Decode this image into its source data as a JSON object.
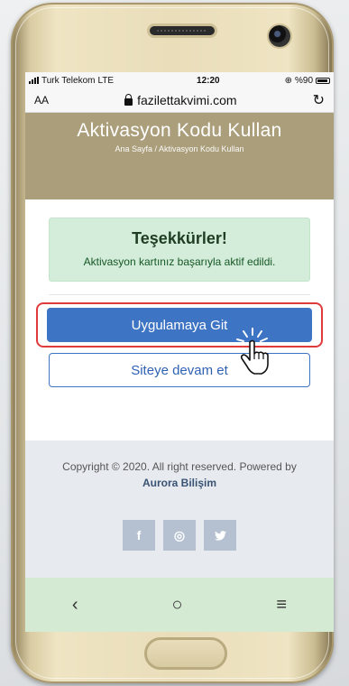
{
  "status": {
    "carrier": "Turk Telekom",
    "network": "LTE",
    "time": "12:20",
    "battery": "%90",
    "battery_level": 0.9
  },
  "browser": {
    "text_size": "AA",
    "url": "fazilettakvimi.com"
  },
  "hero": {
    "title": "Aktivasyon Kodu Kullan",
    "breadcrumb": "Ana Sayfa / Aktivasyon Kodu Kullan"
  },
  "alert": {
    "title": "Teşekkürler!",
    "message": "Aktivasyon kartınız başarıyla aktif edildi."
  },
  "buttons": {
    "primary": "Uygulamaya Git",
    "secondary": "Siteye devam et"
  },
  "footer": {
    "copyright": "Copyright © 2020. All right reserved. Powered by",
    "company": "Aurora Bilişim"
  },
  "social": {
    "facebook": "f",
    "instagram": "◎",
    "twitter": "🐦"
  },
  "nav": {
    "back": "‹",
    "home": "○",
    "recents": "≡"
  },
  "colors": {
    "hero": "#ab9e7b",
    "primary": "#3e74c4",
    "alert_bg": "#d4edda",
    "highlight": "#e03a3a"
  }
}
